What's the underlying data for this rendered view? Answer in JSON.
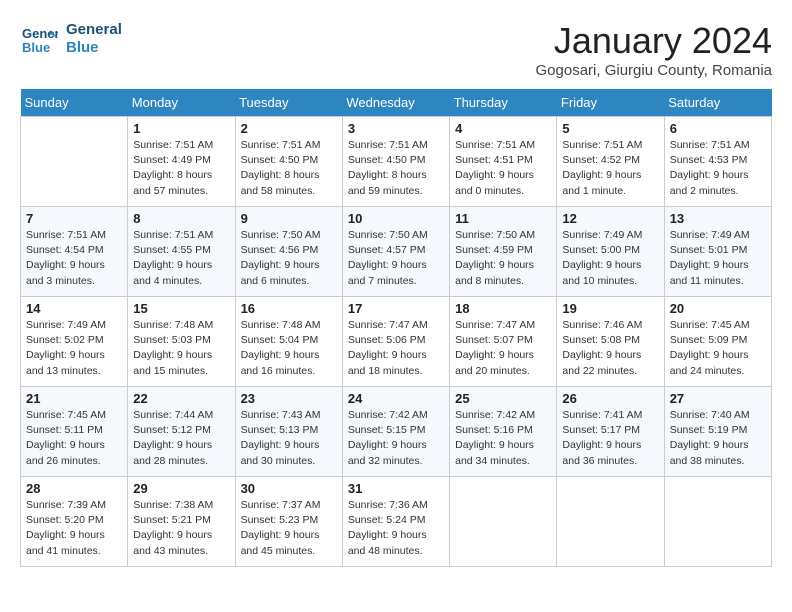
{
  "header": {
    "logo_line1": "General",
    "logo_line2": "Blue",
    "title": "January 2024",
    "subtitle": "Gogosari, Giurgiu County, Romania"
  },
  "days_of_week": [
    "Sunday",
    "Monday",
    "Tuesday",
    "Wednesday",
    "Thursday",
    "Friday",
    "Saturday"
  ],
  "weeks": [
    [
      {
        "day": "",
        "sunrise": "",
        "sunset": "",
        "daylight": ""
      },
      {
        "day": "1",
        "sunrise": "Sunrise: 7:51 AM",
        "sunset": "Sunset: 4:49 PM",
        "daylight": "Daylight: 8 hours and 57 minutes."
      },
      {
        "day": "2",
        "sunrise": "Sunrise: 7:51 AM",
        "sunset": "Sunset: 4:50 PM",
        "daylight": "Daylight: 8 hours and 58 minutes."
      },
      {
        "day": "3",
        "sunrise": "Sunrise: 7:51 AM",
        "sunset": "Sunset: 4:50 PM",
        "daylight": "Daylight: 8 hours and 59 minutes."
      },
      {
        "day": "4",
        "sunrise": "Sunrise: 7:51 AM",
        "sunset": "Sunset: 4:51 PM",
        "daylight": "Daylight: 9 hours and 0 minutes."
      },
      {
        "day": "5",
        "sunrise": "Sunrise: 7:51 AM",
        "sunset": "Sunset: 4:52 PM",
        "daylight": "Daylight: 9 hours and 1 minute."
      },
      {
        "day": "6",
        "sunrise": "Sunrise: 7:51 AM",
        "sunset": "Sunset: 4:53 PM",
        "daylight": "Daylight: 9 hours and 2 minutes."
      }
    ],
    [
      {
        "day": "7",
        "sunrise": "Sunrise: 7:51 AM",
        "sunset": "Sunset: 4:54 PM",
        "daylight": "Daylight: 9 hours and 3 minutes."
      },
      {
        "day": "8",
        "sunrise": "Sunrise: 7:51 AM",
        "sunset": "Sunset: 4:55 PM",
        "daylight": "Daylight: 9 hours and 4 minutes."
      },
      {
        "day": "9",
        "sunrise": "Sunrise: 7:50 AM",
        "sunset": "Sunset: 4:56 PM",
        "daylight": "Daylight: 9 hours and 6 minutes."
      },
      {
        "day": "10",
        "sunrise": "Sunrise: 7:50 AM",
        "sunset": "Sunset: 4:57 PM",
        "daylight": "Daylight: 9 hours and 7 minutes."
      },
      {
        "day": "11",
        "sunrise": "Sunrise: 7:50 AM",
        "sunset": "Sunset: 4:59 PM",
        "daylight": "Daylight: 9 hours and 8 minutes."
      },
      {
        "day": "12",
        "sunrise": "Sunrise: 7:49 AM",
        "sunset": "Sunset: 5:00 PM",
        "daylight": "Daylight: 9 hours and 10 minutes."
      },
      {
        "day": "13",
        "sunrise": "Sunrise: 7:49 AM",
        "sunset": "Sunset: 5:01 PM",
        "daylight": "Daylight: 9 hours and 11 minutes."
      }
    ],
    [
      {
        "day": "14",
        "sunrise": "Sunrise: 7:49 AM",
        "sunset": "Sunset: 5:02 PM",
        "daylight": "Daylight: 9 hours and 13 minutes."
      },
      {
        "day": "15",
        "sunrise": "Sunrise: 7:48 AM",
        "sunset": "Sunset: 5:03 PM",
        "daylight": "Daylight: 9 hours and 15 minutes."
      },
      {
        "day": "16",
        "sunrise": "Sunrise: 7:48 AM",
        "sunset": "Sunset: 5:04 PM",
        "daylight": "Daylight: 9 hours and 16 minutes."
      },
      {
        "day": "17",
        "sunrise": "Sunrise: 7:47 AM",
        "sunset": "Sunset: 5:06 PM",
        "daylight": "Daylight: 9 hours and 18 minutes."
      },
      {
        "day": "18",
        "sunrise": "Sunrise: 7:47 AM",
        "sunset": "Sunset: 5:07 PM",
        "daylight": "Daylight: 9 hours and 20 minutes."
      },
      {
        "day": "19",
        "sunrise": "Sunrise: 7:46 AM",
        "sunset": "Sunset: 5:08 PM",
        "daylight": "Daylight: 9 hours and 22 minutes."
      },
      {
        "day": "20",
        "sunrise": "Sunrise: 7:45 AM",
        "sunset": "Sunset: 5:09 PM",
        "daylight": "Daylight: 9 hours and 24 minutes."
      }
    ],
    [
      {
        "day": "21",
        "sunrise": "Sunrise: 7:45 AM",
        "sunset": "Sunset: 5:11 PM",
        "daylight": "Daylight: 9 hours and 26 minutes."
      },
      {
        "day": "22",
        "sunrise": "Sunrise: 7:44 AM",
        "sunset": "Sunset: 5:12 PM",
        "daylight": "Daylight: 9 hours and 28 minutes."
      },
      {
        "day": "23",
        "sunrise": "Sunrise: 7:43 AM",
        "sunset": "Sunset: 5:13 PM",
        "daylight": "Daylight: 9 hours and 30 minutes."
      },
      {
        "day": "24",
        "sunrise": "Sunrise: 7:42 AM",
        "sunset": "Sunset: 5:15 PM",
        "daylight": "Daylight: 9 hours and 32 minutes."
      },
      {
        "day": "25",
        "sunrise": "Sunrise: 7:42 AM",
        "sunset": "Sunset: 5:16 PM",
        "daylight": "Daylight: 9 hours and 34 minutes."
      },
      {
        "day": "26",
        "sunrise": "Sunrise: 7:41 AM",
        "sunset": "Sunset: 5:17 PM",
        "daylight": "Daylight: 9 hours and 36 minutes."
      },
      {
        "day": "27",
        "sunrise": "Sunrise: 7:40 AM",
        "sunset": "Sunset: 5:19 PM",
        "daylight": "Daylight: 9 hours and 38 minutes."
      }
    ],
    [
      {
        "day": "28",
        "sunrise": "Sunrise: 7:39 AM",
        "sunset": "Sunset: 5:20 PM",
        "daylight": "Daylight: 9 hours and 41 minutes."
      },
      {
        "day": "29",
        "sunrise": "Sunrise: 7:38 AM",
        "sunset": "Sunset: 5:21 PM",
        "daylight": "Daylight: 9 hours and 43 minutes."
      },
      {
        "day": "30",
        "sunrise": "Sunrise: 7:37 AM",
        "sunset": "Sunset: 5:23 PM",
        "daylight": "Daylight: 9 hours and 45 minutes."
      },
      {
        "day": "31",
        "sunrise": "Sunrise: 7:36 AM",
        "sunset": "Sunset: 5:24 PM",
        "daylight": "Daylight: 9 hours and 48 minutes."
      },
      {
        "day": "",
        "sunrise": "",
        "sunset": "",
        "daylight": ""
      },
      {
        "day": "",
        "sunrise": "",
        "sunset": "",
        "daylight": ""
      },
      {
        "day": "",
        "sunrise": "",
        "sunset": "",
        "daylight": ""
      }
    ]
  ]
}
